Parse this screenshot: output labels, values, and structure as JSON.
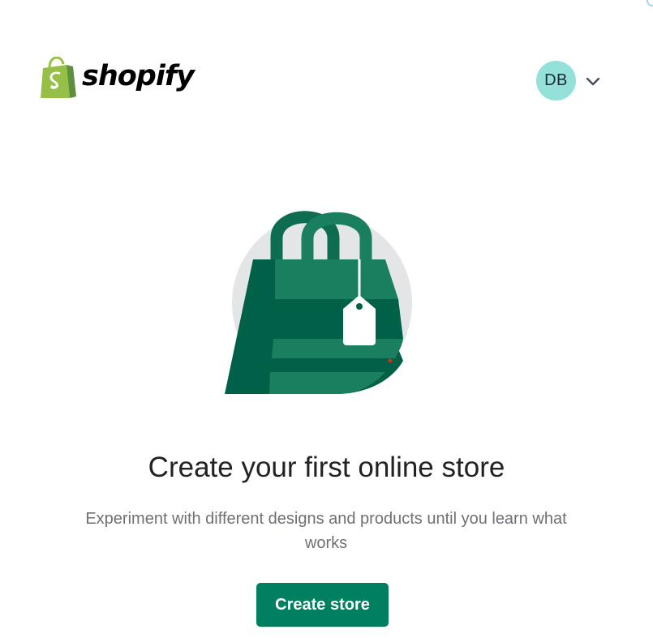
{
  "brand": {
    "logo_text": "shopify",
    "logo_icon": "shopify-bag-icon",
    "logo_color": "#95bf47"
  },
  "account": {
    "initials": "DB",
    "avatar_color": "#93e1d8",
    "menu_icon": "chevron-down-icon"
  },
  "hero": {
    "illustration": "shopping-bag-with-tag-illustration",
    "title": "Create your first online store",
    "subtitle": "Experiment with different designs and products until you learn what works"
  },
  "actions": {
    "create_store_label": "Create store",
    "primary_color": "#008060"
  }
}
